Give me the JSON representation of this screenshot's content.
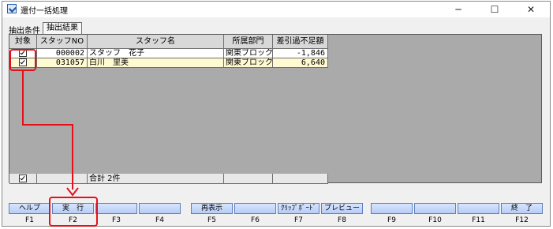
{
  "window": {
    "title": "還付一括処理",
    "minimize_label": "─",
    "maximize_label": "☐",
    "close_label": "✕"
  },
  "tabs": {
    "label": "抽出条件",
    "active_tab": "抽出結果"
  },
  "table": {
    "headers": [
      "対象",
      "スタッフNO",
      "スタッフ名",
      "所属部門",
      "差引過不足額"
    ],
    "rows": [
      {
        "checked": true,
        "staff_no": "000002",
        "name": "スタッフ　花子",
        "dept": "関東ブロック",
        "amount": "-1,846"
      },
      {
        "checked": true,
        "staff_no": "031057",
        "name": "白川　里美",
        "dept": "関東ブロック",
        "amount": "6,640"
      }
    ],
    "footer": {
      "checked": true,
      "total_label": "合計 2件"
    }
  },
  "fkeys": [
    {
      "label": "ヘルプ",
      "key": "F1"
    },
    {
      "label": "実　行",
      "key": "F2"
    },
    {
      "label": "",
      "key": "F3"
    },
    {
      "label": "",
      "key": "F4"
    },
    {
      "label": "再表示",
      "key": "F5"
    },
    {
      "label": "",
      "key": "F6"
    },
    {
      "label": "ｸﾘｯﾌﾟﾎﾞｰﾄﾞ",
      "key": "F7"
    },
    {
      "label": "プレビュー",
      "key": "F8"
    },
    {
      "label": "",
      "key": "F9"
    },
    {
      "label": "",
      "key": "F10"
    },
    {
      "label": "",
      "key": "F11"
    },
    {
      "label": "終　了",
      "key": "F12"
    }
  ],
  "colors": {
    "annotation_red": "#e6101a",
    "row_highlight": "#fffad2",
    "grid_bg": "#aaaaaa",
    "fkey_blue": "#b8cdf5"
  }
}
